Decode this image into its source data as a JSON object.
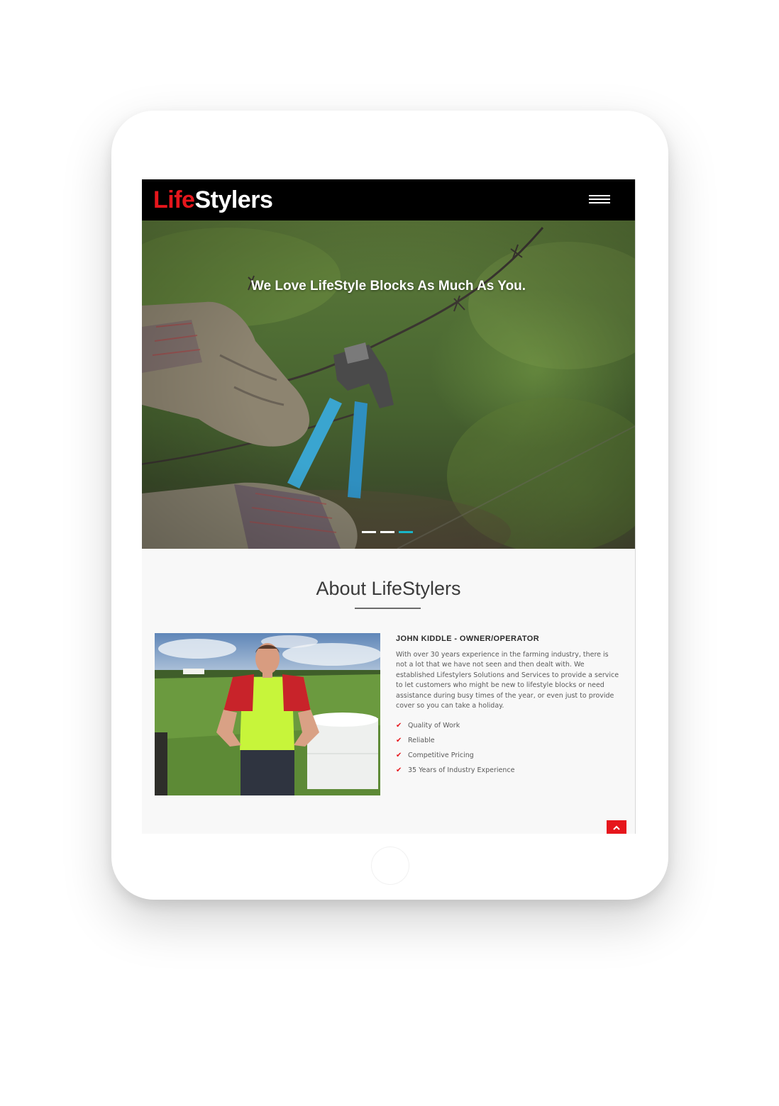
{
  "brand": {
    "logo_part1": "Life",
    "logo_part2": "Stylers",
    "accent_color": "#e6161c"
  },
  "nav": {
    "menu_icon": "hamburger-menu-icon"
  },
  "hero": {
    "heading": "We Love LifeStyle Blocks As Much As You.",
    "slides_count": 3,
    "active_slide": 3,
    "active_dot_color": "#19b5c8"
  },
  "about": {
    "title": "About LifeStylers",
    "owner_name": "JOHN KIDDLE - OWNER/OPERATOR",
    "bio": "With over 30 years experience in the farming industry, there is not a lot that we have not seen and then dealt with. We established Lifestylers Solutions and Services to provide a service to let customers who might be new to lifestyle blocks or need assistance during busy times of the year, or even just to provide cover so you can take a holiday.",
    "features": [
      "Quality of Work",
      "Reliable",
      "Competitive Pricing",
      "35 Years of Industry Experience"
    ],
    "feature_icon": "check-icon"
  },
  "back_to_top": {
    "icon": "chevron-up-icon"
  }
}
